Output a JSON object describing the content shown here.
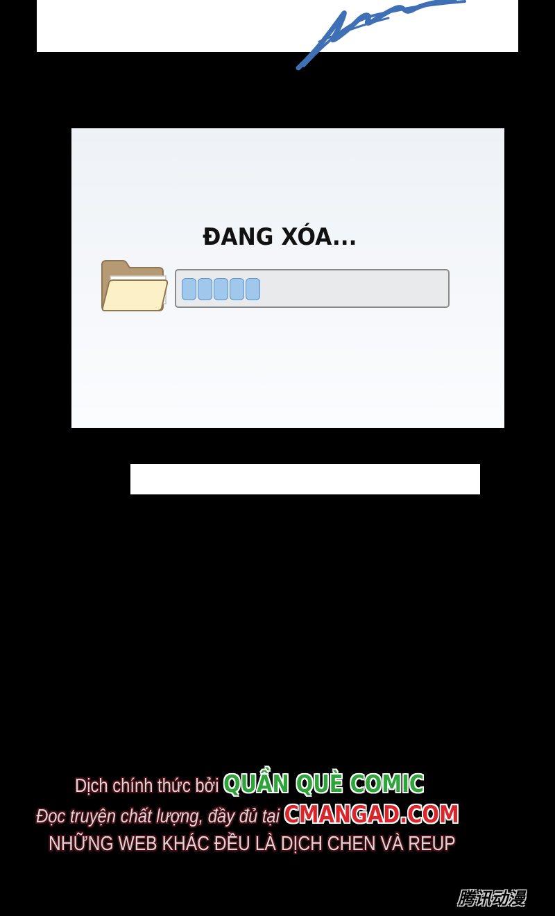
{
  "dialog": {
    "title": "ĐANG XÓA...",
    "progress": {
      "filled_segments": 5
    },
    "icon": "folder-icon"
  },
  "credits": {
    "line1_prefix": "Dịch chính thức bởi",
    "line1_highlight": "QUẦN QUÈ COMIC",
    "line2_prefix": "Đọc truyện chất lượng, đầy đủ tại",
    "line2_highlight": "CMANGAD.COM",
    "line3": "NHỮNG WEB KHÁC ĐỀU LÀ DỊCH CHEN VÀ REUP"
  },
  "watermark": "腾讯动漫",
  "colors": {
    "background": "#000000",
    "panel": "#ffffff",
    "progress_fill": "#9fc8ec",
    "progress_border": "#5c93c9",
    "credit_green": "#2ea43a",
    "credit_red": "#d8262c",
    "signature_blue": "#3f6fb4"
  }
}
